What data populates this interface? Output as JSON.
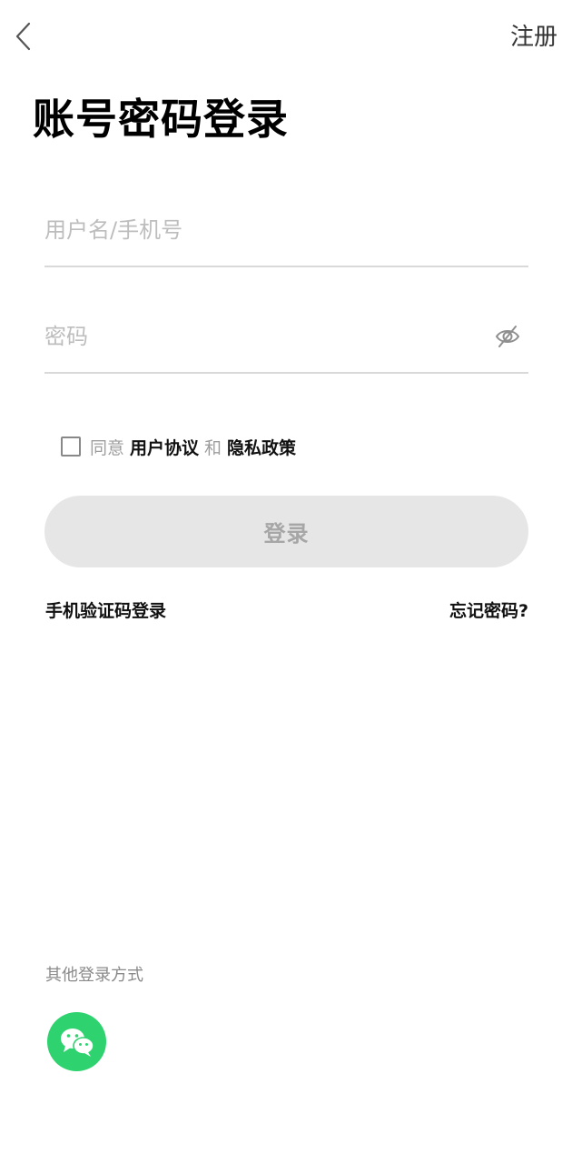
{
  "header": {
    "back_icon": "chevron-left-icon",
    "register_label": "注册"
  },
  "title": "账号密码登录",
  "form": {
    "username_placeholder": "用户名/手机号",
    "username_value": "",
    "password_placeholder": "密码",
    "password_value": "",
    "password_visibility_icon": "eye-off-icon"
  },
  "agreement": {
    "checked": false,
    "prefix": "同意",
    "user_agreement": "用户协议",
    "conjunction": "和",
    "privacy_policy": "隐私政策"
  },
  "login_button_label": "登录",
  "links": {
    "sms_login": "手机验证码登录",
    "forgot_password": "忘记密码?"
  },
  "other_login": {
    "title": "其他登录方式",
    "methods": [
      {
        "icon": "wechat-icon",
        "color": "#2ED36F"
      }
    ]
  },
  "colors": {
    "accent_green": "#2ED36F",
    "button_disabled_bg": "#E6E6E6",
    "button_disabled_text": "#A6A6A6",
    "placeholder": "#BDBDBD"
  }
}
